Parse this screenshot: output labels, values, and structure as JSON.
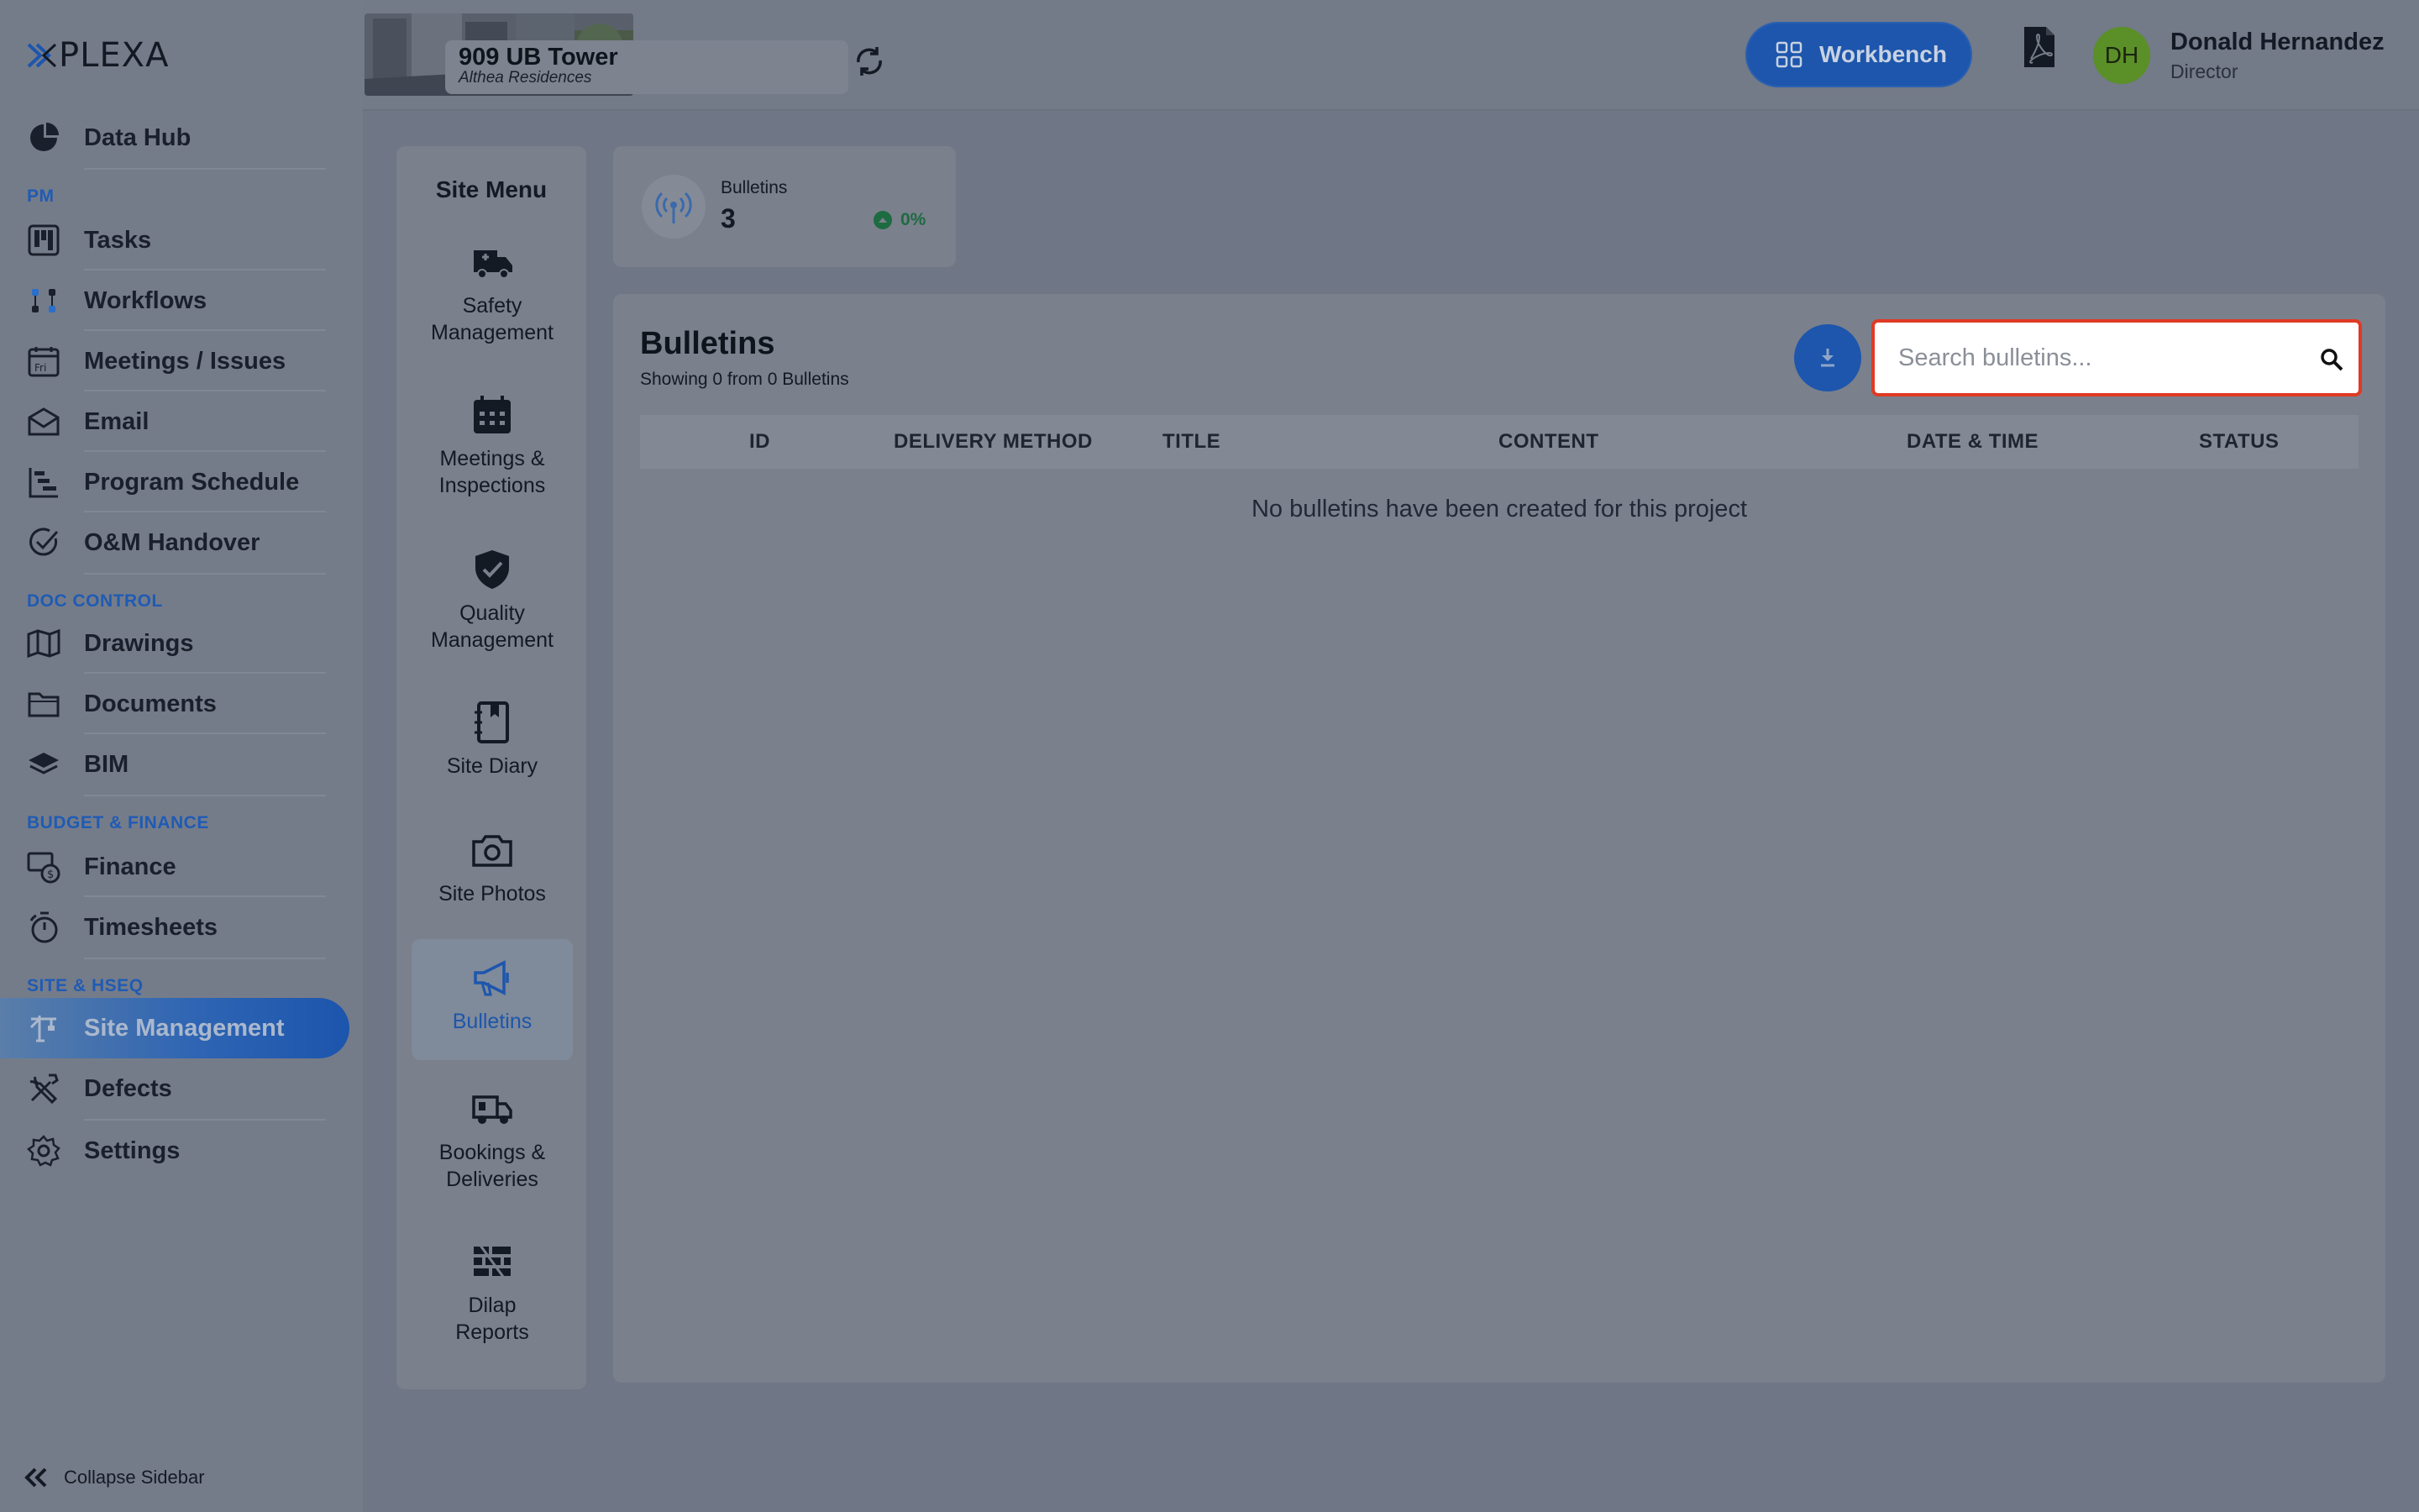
{
  "brand": {
    "logo_text": "PLEXA"
  },
  "sidebar": {
    "items": [
      {
        "label": "Data Hub",
        "icon": "pie-chart-icon"
      },
      {
        "section": "PM"
      },
      {
        "label": "Tasks",
        "icon": "kanban-icon"
      },
      {
        "label": "Workflows",
        "icon": "workflow-icon"
      },
      {
        "label": "Meetings / Issues",
        "icon": "calendar-icon"
      },
      {
        "label": "Email",
        "icon": "envelope-icon"
      },
      {
        "label": "Program Schedule",
        "icon": "gantt-icon"
      },
      {
        "label": "O&M Handover",
        "icon": "check-circle-icon"
      },
      {
        "section": "DOC CONTROL"
      },
      {
        "label": "Drawings",
        "icon": "map-icon"
      },
      {
        "label": "Documents",
        "icon": "folder-icon"
      },
      {
        "label": "BIM",
        "icon": "layers-icon"
      },
      {
        "section": "BUDGET & FINANCE"
      },
      {
        "label": "Finance",
        "icon": "finance-icon"
      },
      {
        "label": "Timesheets",
        "icon": "stopwatch-icon"
      },
      {
        "section": "SITE & HSEQ"
      },
      {
        "label": "Site Management",
        "icon": "crane-icon",
        "active": true
      },
      {
        "label": "Defects",
        "icon": "tools-icon"
      },
      {
        "label": "Settings",
        "icon": "gear-icon"
      }
    ],
    "collapse_label": "Collapse Sidebar"
  },
  "header": {
    "project_name": "909 UB Tower",
    "project_sub": "Althea Residences",
    "workbench_label": "Workbench",
    "user": {
      "initials": "DH",
      "name": "Donald Hernandez",
      "role": "Director"
    }
  },
  "site_menu": {
    "title": "Site Menu",
    "items": [
      {
        "label": "Safety Management",
        "icon": "ambulance-icon"
      },
      {
        "label": "Meetings & Inspections",
        "icon": "calendar-grid-icon"
      },
      {
        "label": "Quality Management",
        "icon": "shield-check-icon"
      },
      {
        "label": "Site Diary",
        "icon": "diary-icon"
      },
      {
        "label": "Site Photos",
        "icon": "camera-icon"
      },
      {
        "label": "Bulletins",
        "icon": "megaphone-icon",
        "active": true
      },
      {
        "label": "Bookings & Deliveries",
        "icon": "truck-icon"
      },
      {
        "label": "Dilap Reports",
        "icon": "bricks-icon"
      }
    ]
  },
  "stat": {
    "label": "Bulletins",
    "value": "3",
    "change": "0%"
  },
  "bulletins": {
    "title": "Bulletins",
    "subtitle": "Showing 0 from 0 Bulletins",
    "search_placeholder": "Search bulletins...",
    "columns": [
      "ID",
      "DELIVERY METHOD",
      "TITLE",
      "CONTENT",
      "DATE & TIME",
      "STATUS"
    ],
    "empty_message": "No bulletins have been created for this project"
  },
  "colors": {
    "accent": "#1d56ac",
    "highlight": "#e03a24",
    "section": "#1f5bb4",
    "positive": "#1d6b41"
  }
}
